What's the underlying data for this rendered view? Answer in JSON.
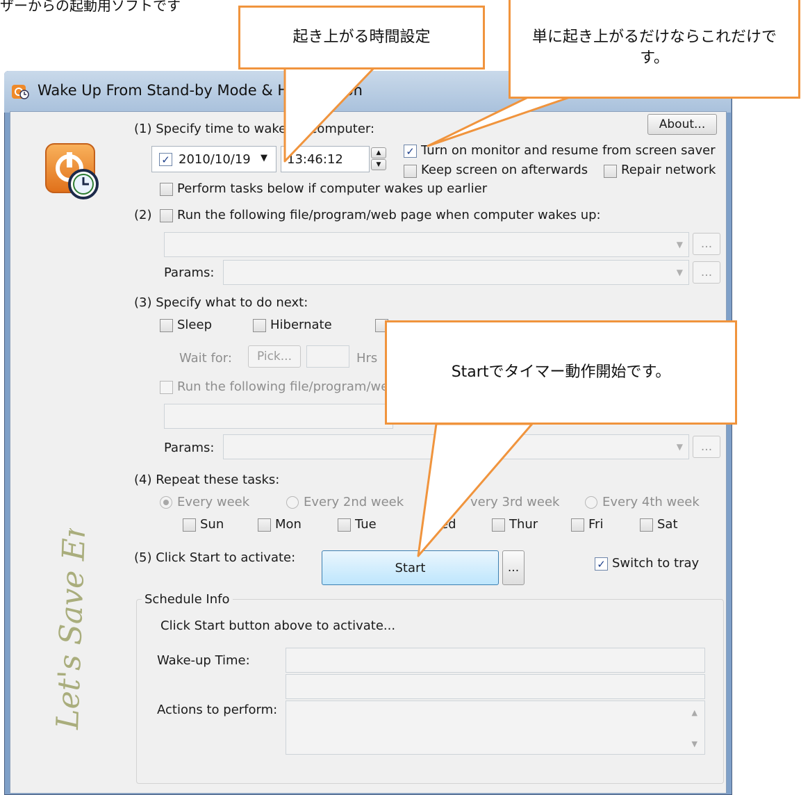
{
  "page_heading": "ザーからの起動用ソフトです",
  "window": {
    "title": "Wake Up From Stand-by Mode & Hibernation",
    "about_label": "About..."
  },
  "section1": {
    "heading": "(1) Specify time to wake up computer:",
    "date_value": "2010/10/19",
    "date_checked": true,
    "time_value": "13:46:12",
    "monitor_label": "Turn on monitor and resume from screen saver",
    "monitor_checked": true,
    "keep_screen_label": "Keep screen on afterwards",
    "repair_network_label": "Repair network",
    "perform_tasks_label": "Perform tasks below if computer wakes up earlier"
  },
  "section2": {
    "number": "(2)",
    "run_file_label": "Run the following file/program/web page when computer wakes up:",
    "params_label": "Params:",
    "browse_label": "..."
  },
  "section3": {
    "heading": "(3) Specify what to do next:",
    "sleep_label": "Sleep",
    "hibernate_label": "Hibernate",
    "wait_for_label": "Wait for:",
    "pick_label": "Pick...",
    "hrs_label": "Hrs",
    "run_file_label": "Run the following file/program/we",
    "params_label": "Params:",
    "browse_label": "..."
  },
  "section4": {
    "heading": "(4) Repeat these tasks:",
    "repeat_options": [
      "Every week",
      "Every 2nd week",
      "very 3rd week",
      "Every 4th week"
    ],
    "days": [
      "Sun",
      "Mon",
      "Tue",
      "ed",
      "Thur",
      "Fri",
      "Sat"
    ]
  },
  "section5": {
    "heading": "(5) Click Start to activate:",
    "start_label": "Start",
    "more_label": "...",
    "tray_label": "Switch to tray",
    "tray_checked": true
  },
  "schedule_info": {
    "title": "Schedule Info",
    "status_text": "Click Start button above to activate...",
    "wake_time_label": "Wake-up Time:",
    "actions_label": "Actions to perform:"
  },
  "callouts": {
    "time_setting": "起き上がる時間設定",
    "wake_only": "単に起き上がるだけならこれだけです。",
    "start_timer": "Startでタイマー動作開始です。"
  },
  "colors": {
    "callout_border": "#f0943d",
    "title_bar": "#b7cce3",
    "logo_orange": "#ef8a2a"
  }
}
